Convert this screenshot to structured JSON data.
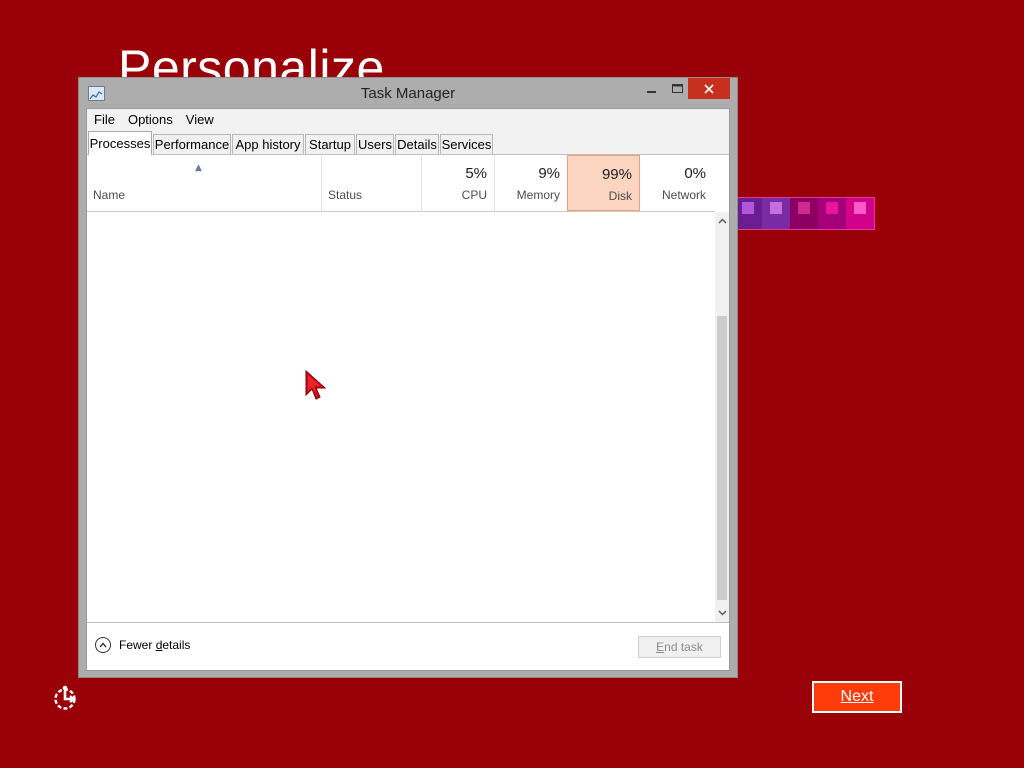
{
  "background": {
    "color": "#9a0007",
    "title": "Personalize"
  },
  "color_swatches": [
    {
      "bg": "#6a1e8f",
      "chip": "#b557dc"
    },
    {
      "bg": "#7a2aa3",
      "chip": "#c46fe0"
    },
    {
      "bg": "#8c0064",
      "chip": "#d02a8f"
    },
    {
      "bg": "#a3007a",
      "chip": "#e6169c"
    },
    {
      "bg": "#d1008a",
      "chip": "#ff5ac8"
    }
  ],
  "task_manager": {
    "title": "Task Manager",
    "menu": [
      "File",
      "Options",
      "View"
    ],
    "tabs": [
      "Processes",
      "Performance",
      "App history",
      "Startup",
      "Users",
      "Details",
      "Services"
    ],
    "active_tab": "Processes",
    "columns": {
      "name": "Name",
      "status": "Status",
      "cpu": {
        "percent": "5%",
        "label": "CPU"
      },
      "memory": {
        "percent": "9%",
        "label": "Memory"
      },
      "disk": {
        "percent": "99%",
        "label": "Disk",
        "highlight": "#fcd5c0"
      },
      "network": {
        "percent": "0%",
        "label": "Network"
      }
    },
    "footer": {
      "fewer_details_prefix": "Fewer ",
      "fewer_details_access": "d",
      "fewer_details_rest": "etails",
      "end_task_access": "E",
      "end_task_rest": "nd task"
    }
  },
  "oobe": {
    "next_access": "N",
    "next_rest": "ext"
  },
  "colors": {
    "accent": "#ff3c0a",
    "close_button": "#c7301f",
    "cursor": "#d10a1a"
  }
}
